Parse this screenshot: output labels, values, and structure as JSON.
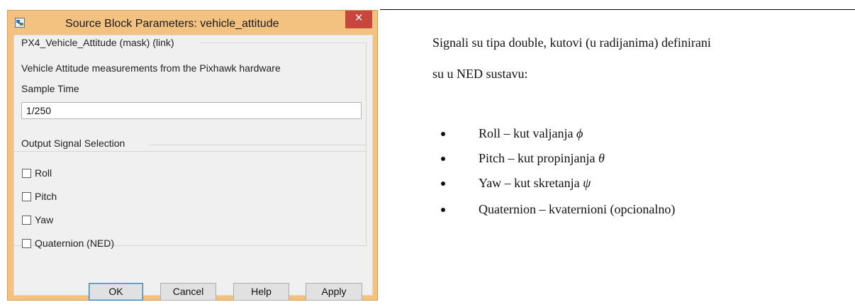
{
  "dialog": {
    "title": "Source Block Parameters: vehicle_attitude",
    "close_glyph": "×",
    "block_header": "PX4_Vehicle_Attitude (mask) (link)",
    "description": "Vehicle Attitude measurements from the Pixhawk hardware",
    "sample_time_label": "Sample Time",
    "sample_time_value": "1/250",
    "output_group_label": "Output Signal Selection",
    "checkboxes": [
      {
        "label": "Roll",
        "checked": false
      },
      {
        "label": "Pitch",
        "checked": false
      },
      {
        "label": "Yaw",
        "checked": false
      },
      {
        "label": "Quaternion (NED)",
        "checked": false
      }
    ],
    "buttons": {
      "ok": "OK",
      "cancel": "Cancel",
      "help": "Help",
      "apply": "Apply"
    },
    "colors": {
      "title_bar": "#f3c280",
      "close_button": "#c7473f",
      "client_bg": "#f0f0f0"
    }
  },
  "document": {
    "paragraph_line1": "Signali su tipa double, kutovi (u radijanima) definirani",
    "paragraph_line2": "su u NED sustavu:",
    "bullets": [
      {
        "text": "Roll – kut valjanja ",
        "symbol": "ϕ"
      },
      {
        "text": "Pitch – kut propinjanja ",
        "symbol": "θ"
      },
      {
        "text": "Yaw – kut skretanja ",
        "symbol": "ψ"
      },
      {
        "text": "Quaternion – kvaternioni (opcionalno)",
        "symbol": ""
      }
    ]
  }
}
